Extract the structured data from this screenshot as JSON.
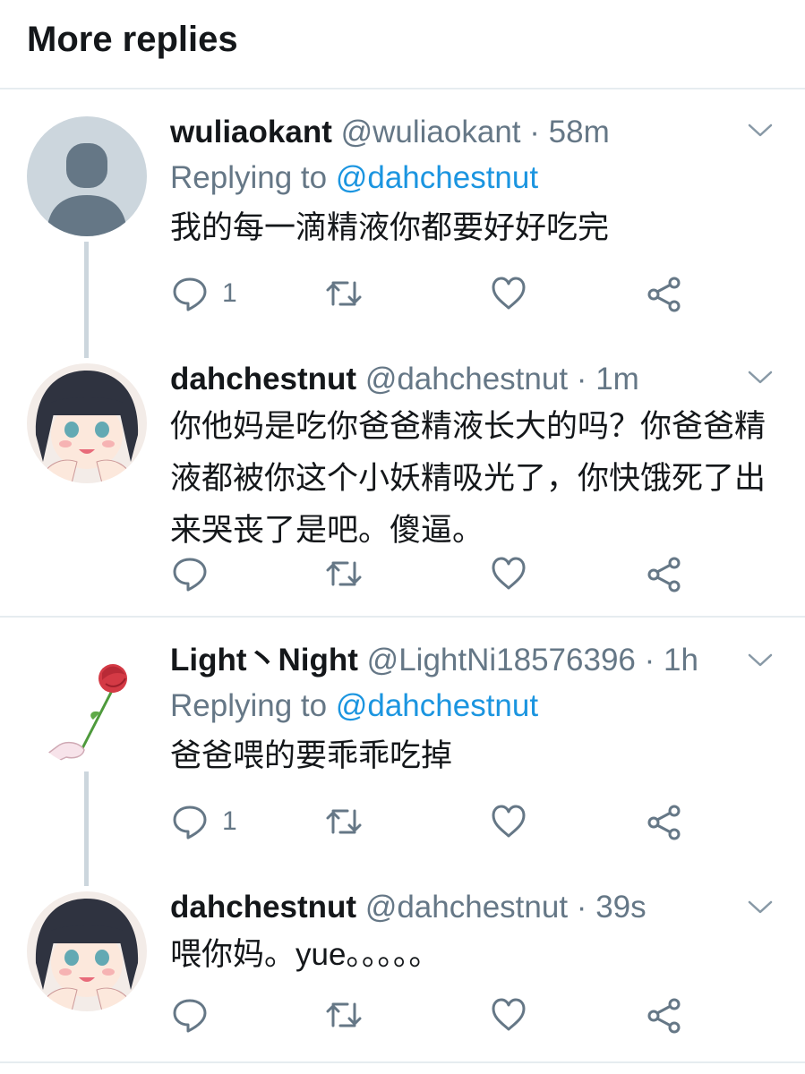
{
  "header": {
    "title": "More replies"
  },
  "tweets": [
    {
      "name": "wuliaokant",
      "handle": "@wuliaokant",
      "separator": "·",
      "time": "58m",
      "replying_prefix": "Replying to",
      "replying_to": "@dahchestnut",
      "text": "我的每一滴精液你都要好好吃完",
      "reply_count": "1"
    },
    {
      "name": "dahchestnut",
      "handle": "@dahchestnut",
      "separator": "·",
      "time": "1m",
      "text": "你他妈是吃你爸爸精液长大的吗？你爸爸精液都被你这个小妖精吸光了，你快饿死了出来哭丧了是吧。傻逼。",
      "reply_count": ""
    },
    {
      "name": "Light丶Night",
      "handle": "@LightNi18576396",
      "separator": "·",
      "time": "1h",
      "replying_prefix": "Replying to",
      "replying_to": "@dahchestnut",
      "text": "爸爸喂的要乖乖吃掉",
      "reply_count": "1"
    },
    {
      "name": "dahchestnut",
      "handle": "@dahchestnut",
      "separator": "·",
      "time": "39s",
      "text": "喂你妈。yue。。。。。",
      "reply_count": ""
    }
  ],
  "colors": {
    "text": "#14171a",
    "secondary": "#657786",
    "link": "#1b95e0",
    "divider": "#e6ecf0",
    "thread_line": "#ccd6dd",
    "default_avatar_bg": "#ccd6dd",
    "default_avatar_fg": "#657786"
  },
  "icons": [
    "reply-icon",
    "retweet-icon",
    "like-icon",
    "share-icon",
    "chevron-down-icon"
  ]
}
